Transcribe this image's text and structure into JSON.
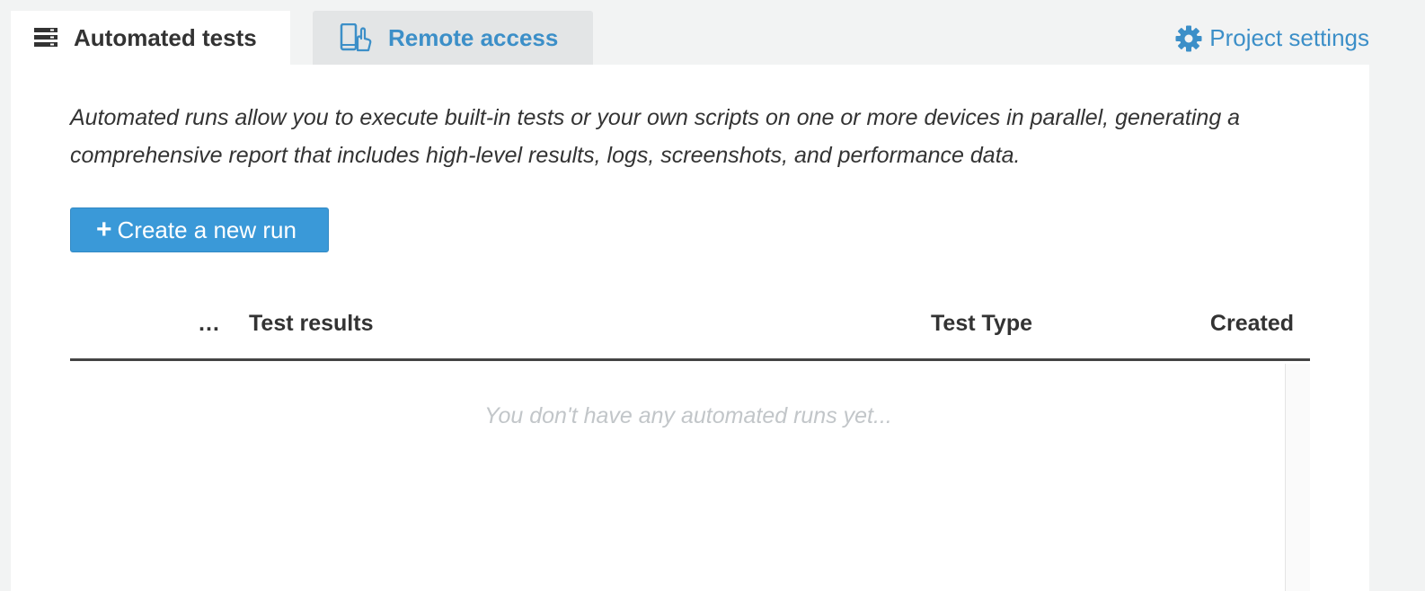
{
  "tabs": {
    "automated": {
      "label": "Automated tests",
      "icon": "server-list-icon"
    },
    "remote": {
      "label": "Remote access",
      "icon": "phone-touch-icon"
    }
  },
  "settings": {
    "label": "Project settings",
    "icon": "gear-icon"
  },
  "description": "Automated runs allow you to execute built-in tests or your own scripts on one or more devices in parallel, generating a comprehensive report that includes high-level results, logs, screenshots, and performance data.",
  "create_button": {
    "icon": "plus-icon",
    "label": "Create a new run"
  },
  "table": {
    "columns": [
      "…",
      "Test results",
      "Test Type",
      "Created"
    ],
    "empty_message": "You don't have any automated runs yet..."
  },
  "colors": {
    "accent": "#3c8fc8",
    "button": "#3a99d8",
    "background": "#f2f3f3",
    "panel": "#ffffff",
    "inactive_tab": "#e3e5e6",
    "empty_text": "#c2c6c9"
  }
}
